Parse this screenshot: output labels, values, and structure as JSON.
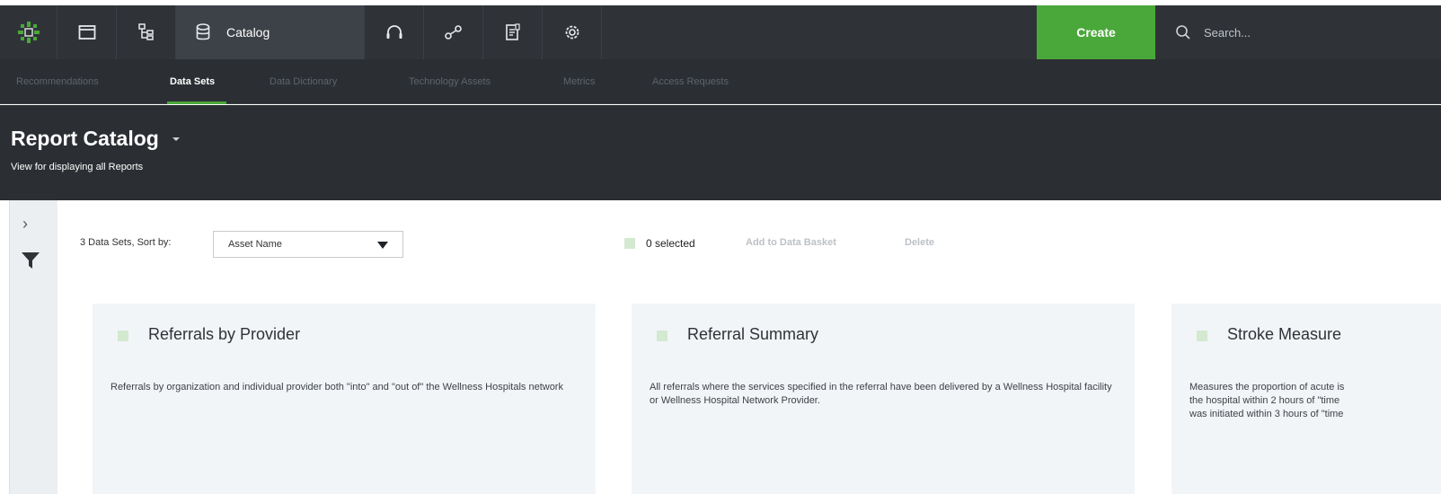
{
  "topbar": {
    "catalog_label": "Catalog",
    "create_label": "Create",
    "search_placeholder": "Search...",
    "accent_color": "#4aa83a"
  },
  "subnav": {
    "tabs": [
      {
        "label": "Recommendations",
        "active": false
      },
      {
        "label": "Data Sets",
        "active": true
      },
      {
        "label": "Data Dictionary",
        "active": false
      },
      {
        "label": "Technology Assets",
        "active": false
      },
      {
        "label": "Metrics",
        "active": false
      },
      {
        "label": "Access Requests",
        "active": false
      }
    ]
  },
  "header": {
    "title": "Report Catalog",
    "subtitle": "View for displaying all Reports"
  },
  "toolbar": {
    "count_label": "3 Data Sets, Sort by:",
    "sort_value": "Asset Name",
    "selected_label": "0 selected",
    "add_to_basket": "Add to Data Basket",
    "delete": "Delete"
  },
  "cards": [
    {
      "title": "Referrals by Provider",
      "description": "Referrals by organization and individual provider both \"into\" and \"out of\" the Wellness Hospitals network"
    },
    {
      "title": "Referral Summary",
      "description": "All referrals where the services specified in the referral have been delivered by a Wellness Hospital facility or Wellness Hospital Network Provider."
    },
    {
      "title": "Stroke Measure",
      "description_lines": [
        "Measures the proportion of acute is",
        "the hospital within 2 hours of \"time",
        "was initiated within 3 hours of \"time"
      ]
    }
  ]
}
